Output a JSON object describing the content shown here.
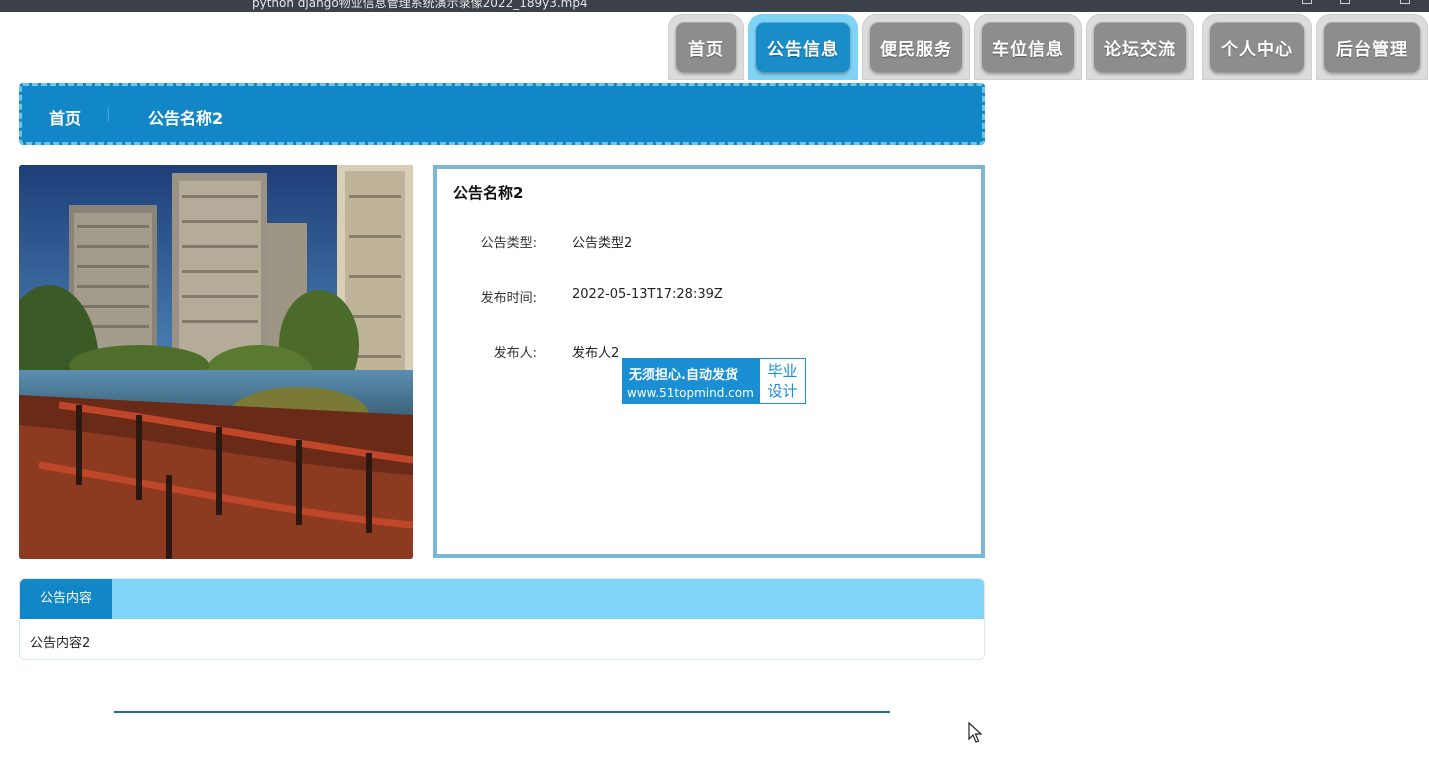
{
  "window": {
    "title": "python django物业信息管理系统演示录像2022_189y3.mp4"
  },
  "nav": {
    "tabs": [
      {
        "label": "首页",
        "active": false
      },
      {
        "label": "公告信息",
        "active": true
      },
      {
        "label": "便民服务",
        "active": false
      },
      {
        "label": "车位信息",
        "active": false
      },
      {
        "label": "论坛交流",
        "active": false
      },
      {
        "label": "个人中心",
        "active": false
      },
      {
        "label": "后台管理",
        "active": false
      }
    ]
  },
  "breadcrumb": {
    "home": "首页",
    "separator": "|",
    "current": "公告名称2"
  },
  "detail": {
    "title": "公告名称2",
    "fields": [
      {
        "label": "公告类型:",
        "value": "公告类型2"
      },
      {
        "label": "发布时间:",
        "value": "2022-05-13T17:28:39Z"
      },
      {
        "label": "发布人:",
        "value": "发布人2"
      }
    ]
  },
  "watermark": {
    "line1": "无须担心.自动发货",
    "line2": "www.51topmind.com",
    "badge_line1": "毕业",
    "badge_line2": "设计"
  },
  "content": {
    "tab_label": "公告内容",
    "body": "公告内容2"
  },
  "colors": {
    "primary": "#1287c8",
    "light": "#7fd4f8",
    "tab_inactive": "#8d8d8d"
  }
}
